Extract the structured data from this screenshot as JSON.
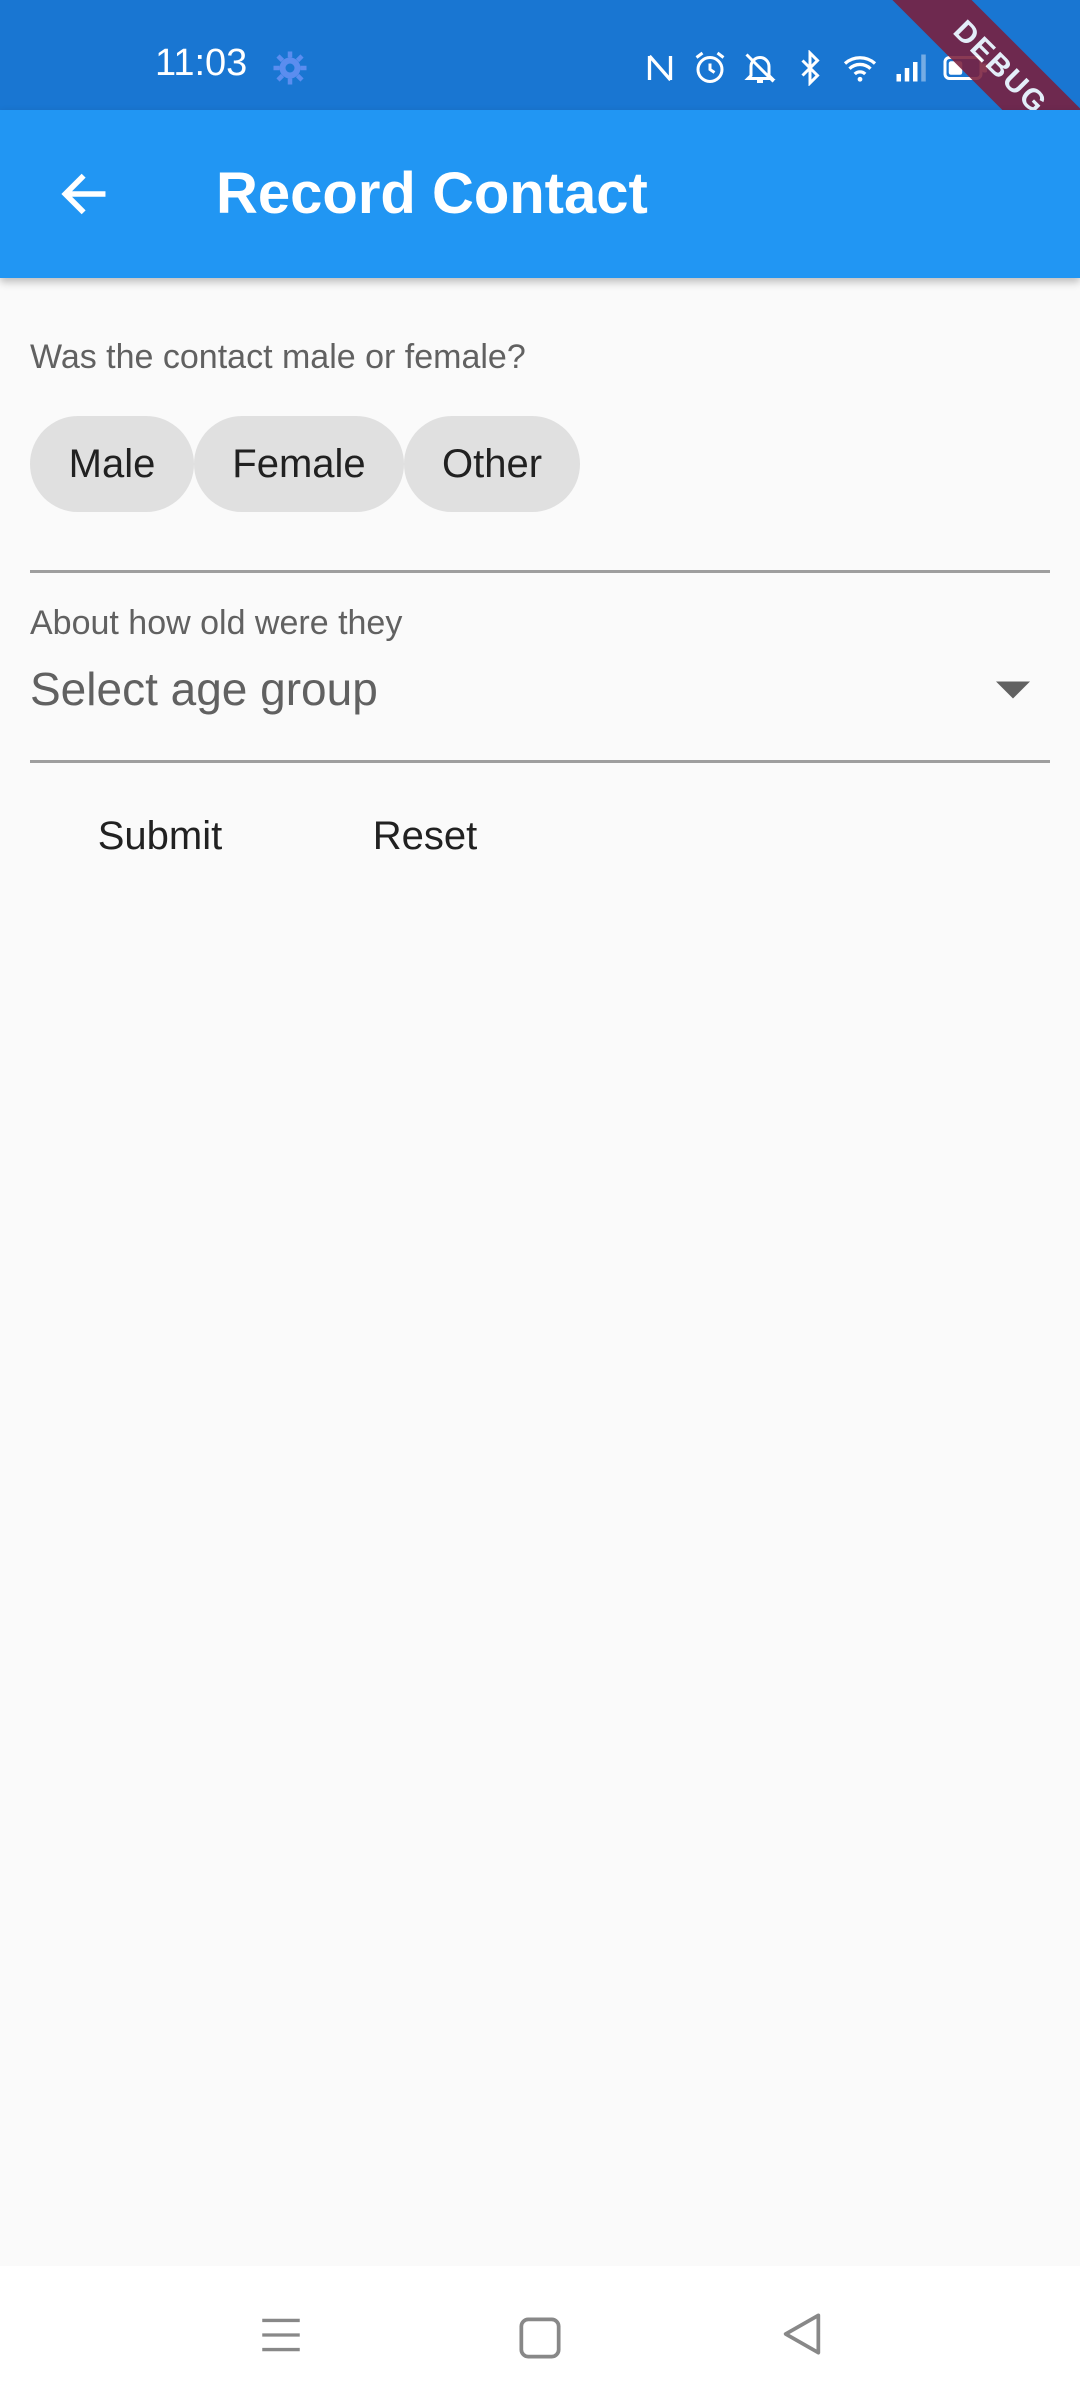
{
  "status_bar": {
    "time": "11:03",
    "icons": [
      "settings-icon",
      "nfc-icon",
      "alarm-icon",
      "bell-off-icon",
      "bluetooth-icon",
      "wifi-icon",
      "signal-icon",
      "battery-icon"
    ]
  },
  "debug_banner": "DEBUG",
  "app_bar": {
    "title": "Record Contact",
    "back_icon": "arrow-back-icon"
  },
  "gender": {
    "question": "Was the contact male or female?",
    "options": [
      "Male",
      "Female",
      "Other"
    ]
  },
  "age": {
    "label": "About how old were they",
    "placeholder": "Select age group"
  },
  "actions": {
    "submit": "Submit",
    "reset": "Reset"
  },
  "colors": {
    "status_bar": "#1976d2",
    "app_bar": "#2196f3",
    "chip": "#e0e0e0",
    "background": "#fafafa"
  }
}
